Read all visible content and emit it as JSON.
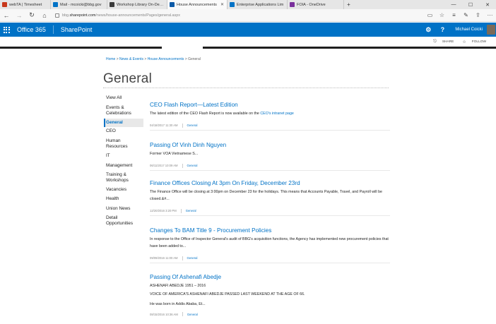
{
  "browser": {
    "tabs": [
      {
        "label": "webTA | Timesheet",
        "color": "#c8381c",
        "active": false
      },
      {
        "label": "Mail - mcoicki@bbg.gov",
        "color": "#0072c6",
        "active": false
      },
      {
        "label": "Workshop Library On-Deman",
        "color": "#3a3a3a",
        "active": false
      },
      {
        "label": "House Announcements",
        "color": "#0d5aa7",
        "active": true
      },
      {
        "label": "Enterprise Applications Lim",
        "color": "#0072c6",
        "active": false
      },
      {
        "label": "FOIA - OneDrive",
        "color": "#7a2f9c",
        "active": false
      }
    ],
    "address_prefix": "bbg.",
    "address_domain": "sharepoint.com",
    "address_path": "/news/house-announcements/Pages/general.aspx"
  },
  "suite": {
    "brand": "Office 365",
    "product": "SharePoint",
    "user_name": "Michael Coicki"
  },
  "page_actions": {
    "share": "SHARE",
    "follow": "FOLLOW"
  },
  "breadcrumb": {
    "home": "Home",
    "news": "News & Events",
    "house": "House Announcements",
    "current": "General",
    "sep": ">"
  },
  "page_title": "General",
  "leftnav": {
    "items": [
      {
        "label": "View All",
        "selected": false
      },
      {
        "label": "Events & Celebrations",
        "selected": false
      },
      {
        "label": "General",
        "selected": true
      },
      {
        "label": "CEO",
        "selected": false
      },
      {
        "label": "Human Resources",
        "selected": false
      },
      {
        "label": "IT",
        "selected": false
      },
      {
        "label": "Management",
        "selected": false
      },
      {
        "label": "Training & Workshops",
        "selected": false
      },
      {
        "label": "Vacancies",
        "selected": false
      },
      {
        "label": "Health",
        "selected": false
      },
      {
        "label": "Union News",
        "selected": false
      },
      {
        "label": "Detail Opportunities",
        "selected": false
      }
    ]
  },
  "articles": [
    {
      "title": "CEO Flash Report—Latest Edition",
      "body": "The latest edition of the CEO Flash Report is now available on the ",
      "link": "CEO's intranet page",
      "date": "04/18/2017 11:30 AM",
      "category": "General"
    },
    {
      "title": "Passing Of Vinh Dinh Nguyen",
      "body": "Former VOA Vietnamese S...",
      "date": "06/11/2017 10:09 AM",
      "category": "General"
    },
    {
      "title": "Finance Offices Closing At 3pm On Friday, December 23rd",
      "body": "The Finance Office will be closing at 3:00pm on December 23 for the holidays.  This means that Accounts Payable, Travel, and Payroll will be closed.&#...",
      "date": "12/20/2016 3:20 PM",
      "category": "General"
    },
    {
      "title": "Changes To BAM Title 9 - Procurement Policies",
      "body": "In response to the Office of Inspector General's audit of BBG's acquisition functions, the Agency has implemented new procurement policies that have been added to...",
      "date": "09/09/2016 11:00 AM",
      "category": "General"
    },
    {
      "title": "Passing Of Ashenafi Abedje",
      "body_lines": [
        "ASHENAFI ABEDJE 1951 – 2016",
        "VOICE OF AMERICA'S ASHENAFI ABEDJE PASSED LAST WEEKEND AT THE AGE OF 66.",
        "He was born in Addis Ababa, Et..."
      ],
      "date": "08/15/2016 10:36 AM",
      "category": "General"
    }
  ]
}
